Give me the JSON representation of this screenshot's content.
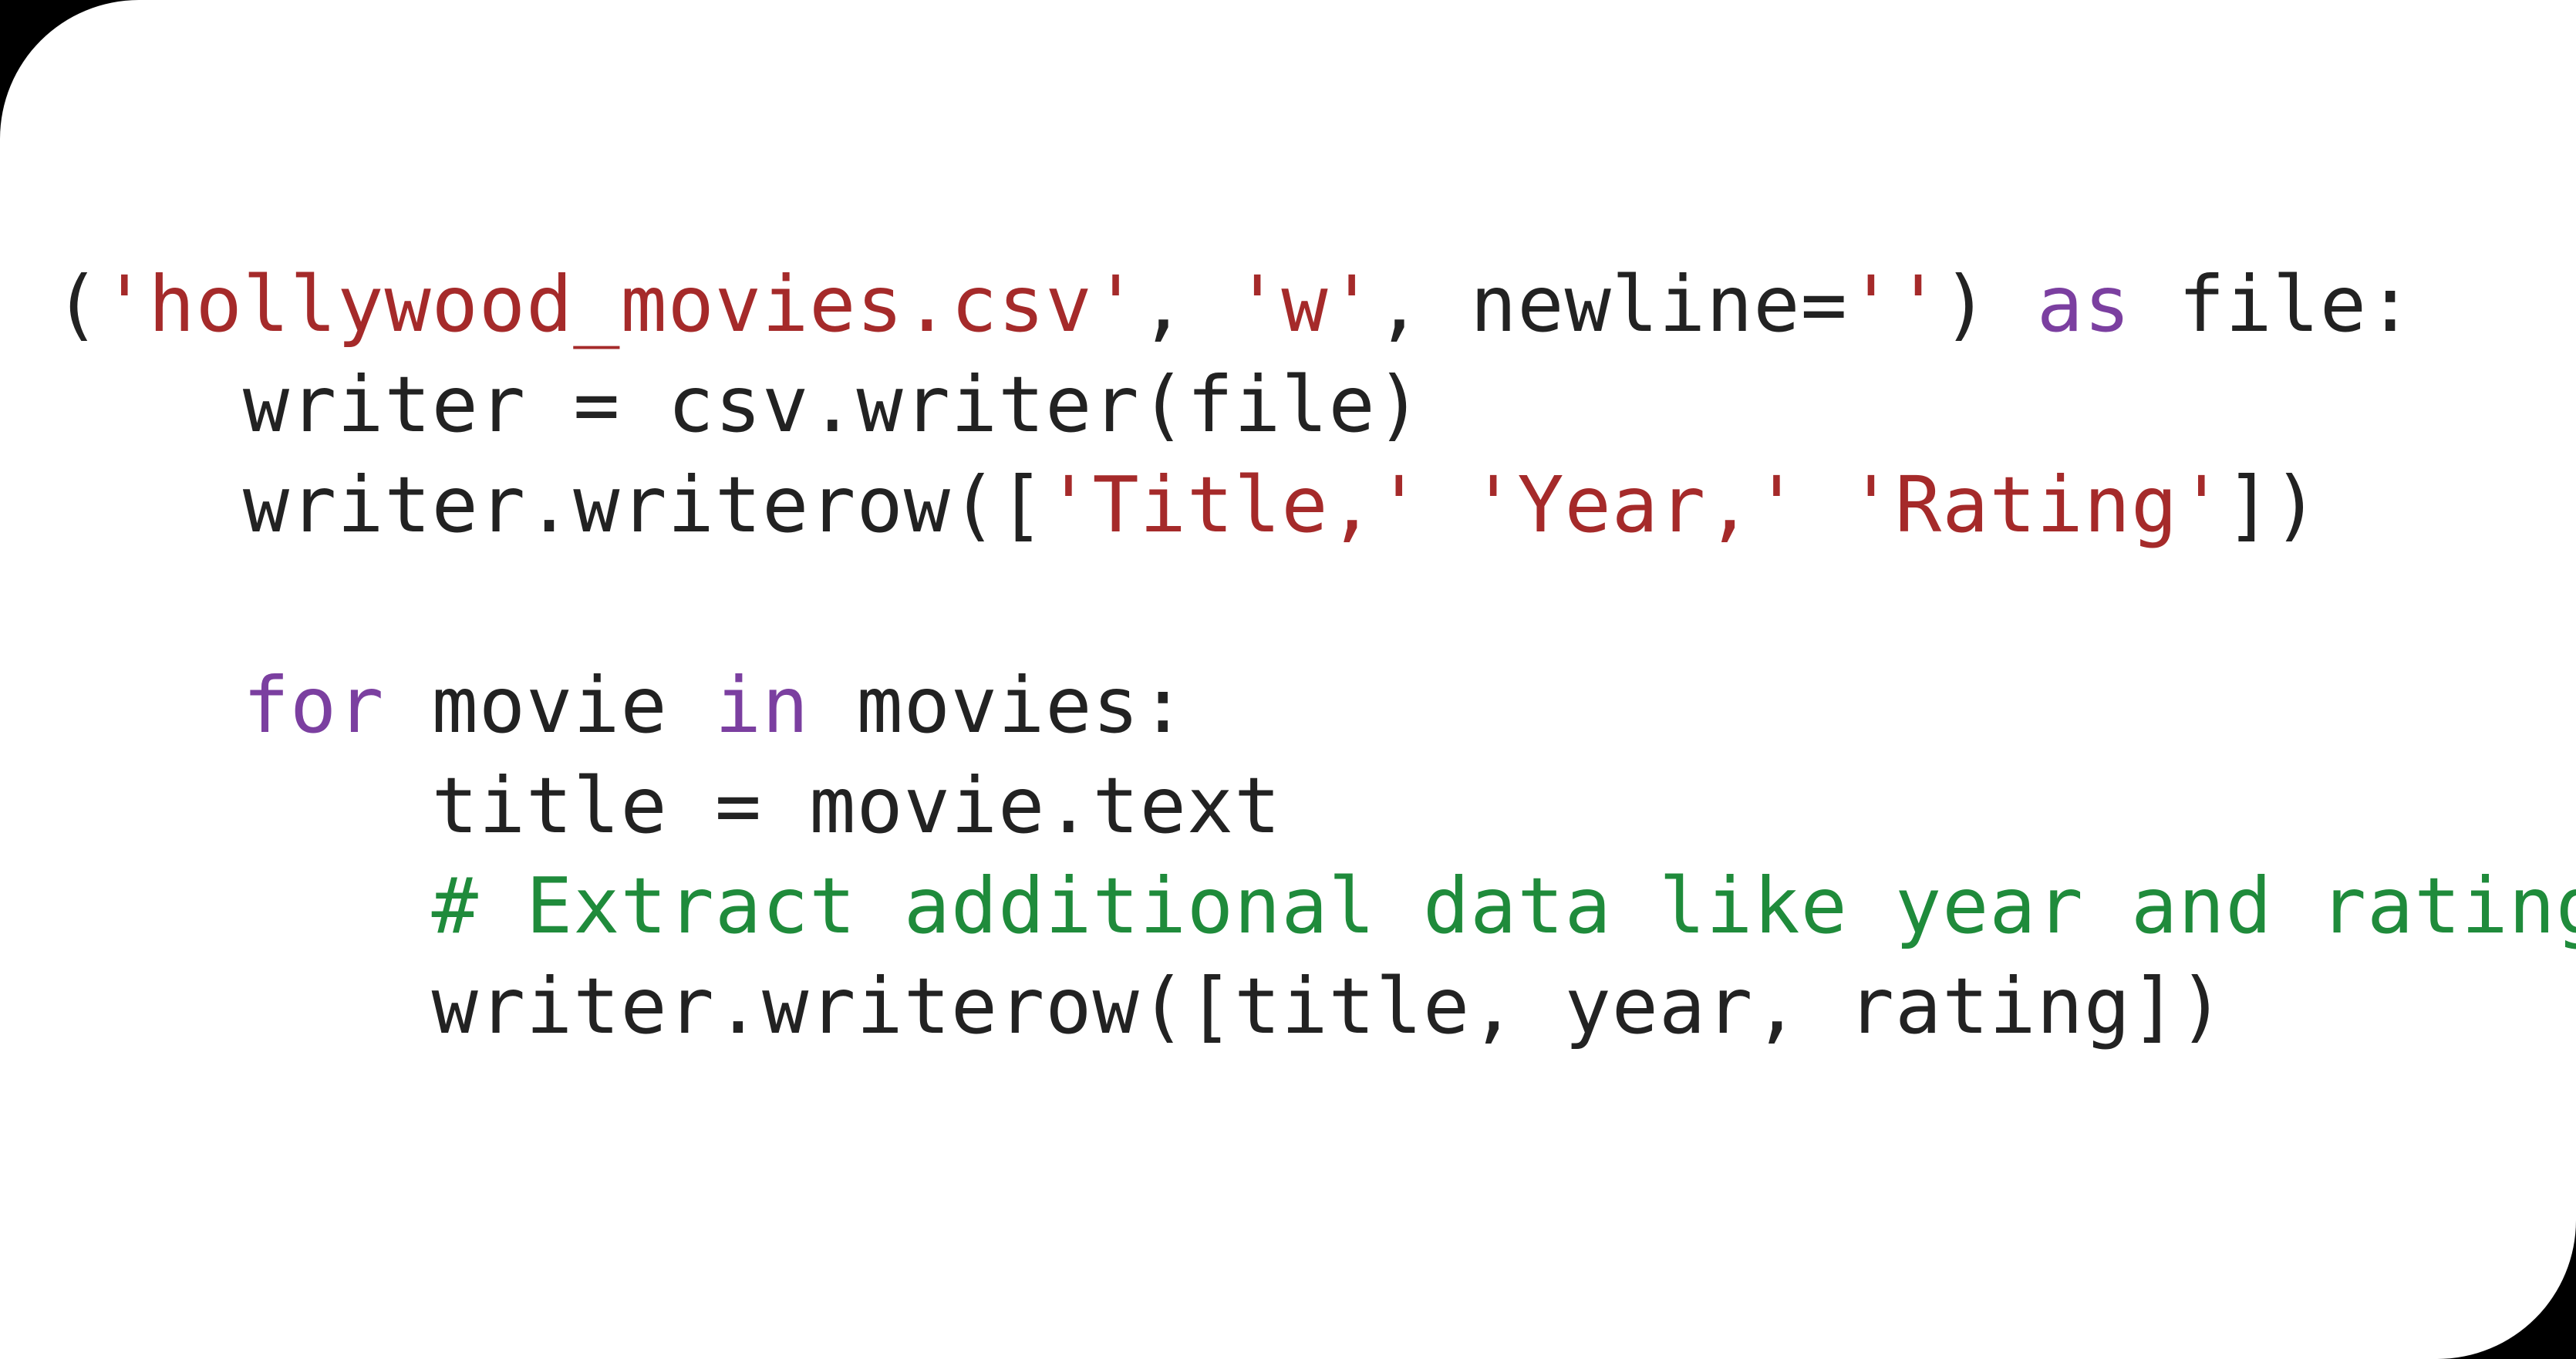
{
  "code": {
    "line1": {
      "a": "(",
      "b": "'hollywood_movies.csv'",
      "c": ", ",
      "d": "'w'",
      "e": ", newline=",
      "f": "''",
      "g": ") ",
      "h": "as",
      "i": " file:"
    },
    "line2": {
      "a": "    writer = csv.writer(file)"
    },
    "line3": {
      "a": "    writer.writerow([",
      "b": "'Title,'",
      "c": " ",
      "d": "'Year,'",
      "e": " ",
      "f": "'Rating'",
      "g": "])"
    },
    "blank": "",
    "line4": {
      "a": "    ",
      "b": "for",
      "c": " movie ",
      "d": "in",
      "e": " movies:"
    },
    "line5": {
      "a": "        title = movie.text"
    },
    "line6": {
      "a": "        ",
      "b": "# Extract additional data like year and rating here"
    },
    "line7": {
      "a": "        writer.writerow([title, year, rating])"
    }
  }
}
